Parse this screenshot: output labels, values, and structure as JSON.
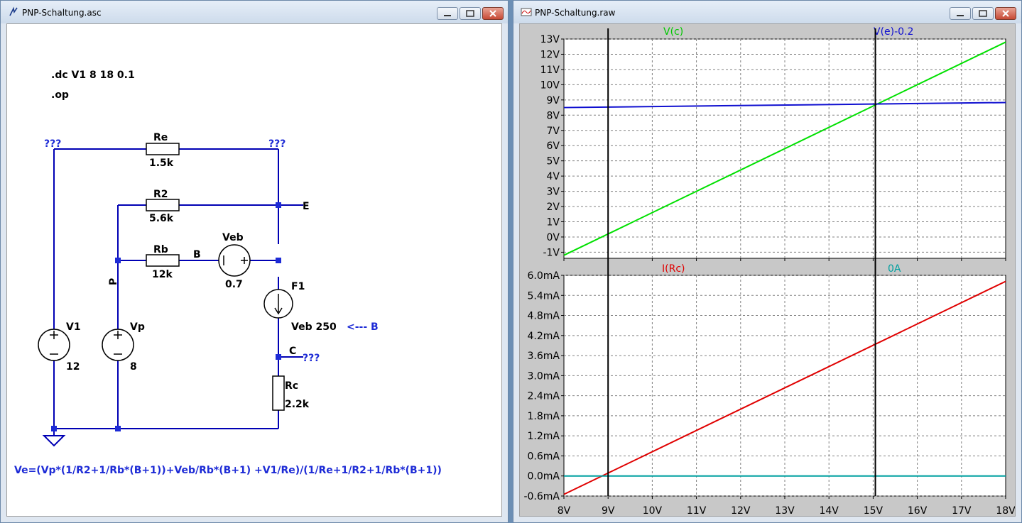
{
  "left_window": {
    "title": "PNP-Schaltung.asc",
    "directives": [
      ".dc V1 8 18 0.1",
      ".op"
    ],
    "nodes": {
      "top_left_unknown": "???",
      "top_right_unknown": "???",
      "collector_unknown": "???",
      "node_E": "E",
      "node_B": "B",
      "node_C": "C",
      "node_P": "P"
    },
    "components": {
      "Re": {
        "name": "Re",
        "value": "1.5k"
      },
      "R2": {
        "name": "R2",
        "value": "5.6k"
      },
      "Rb": {
        "name": "Rb",
        "value": "12k"
      },
      "Veb": {
        "name": "Veb",
        "value": "0.7"
      },
      "F1": {
        "name": "F1",
        "value": "Veb 250"
      },
      "V1": {
        "name": "V1",
        "value": "12"
      },
      "Vp": {
        "name": "Vp",
        "value": "8"
      },
      "Rc": {
        "name": "Rc",
        "value": "2.2k"
      }
    },
    "arrow_note": "<--- B",
    "formula": "Ve=(Vp*(1/R2+1/Rb*(B+1))+Veb/Rb*(B+1) +V1/Re)/(1/Re+1/R2+1/Rb*(B+1))",
    "colors": {
      "wire": "#0000b4",
      "junction": "#1d2bd6",
      "text_blue": "#1d2bd6"
    }
  },
  "right_window": {
    "title": "PNP-Schaltung.raw",
    "top_pane": {
      "traces": [
        {
          "label": "V(c)",
          "color": "#00e000"
        },
        {
          "label": "V(e)-0.2",
          "color": "#1010d0"
        }
      ],
      "y_ticks": [
        "13V",
        "12V",
        "11V",
        "10V",
        "9V",
        "8V",
        "7V",
        "6V",
        "5V",
        "4V",
        "3V",
        "2V",
        "1V",
        "0V",
        "-1V"
      ]
    },
    "bottom_pane": {
      "traces": [
        {
          "label": "I(Rc)",
          "color": "#e00000"
        },
        {
          "label": "0A",
          "color": "#00a0a0"
        }
      ],
      "y_ticks": [
        "6.0mA",
        "5.4mA",
        "4.8mA",
        "4.2mA",
        "3.6mA",
        "3.0mA",
        "2.4mA",
        "1.8mA",
        "1.2mA",
        "0.6mA",
        "0.0mA",
        "-0.6mA"
      ]
    },
    "x_ticks": [
      "8V",
      "9V",
      "10V",
      "11V",
      "12V",
      "13V",
      "14V",
      "15V",
      "16V",
      "17V",
      "18V"
    ],
    "cursors": [
      "9V",
      "15.05V"
    ]
  },
  "chart_data": [
    {
      "type": "line",
      "xlim": [
        8,
        18
      ],
      "ylim": [
        -1.4,
        13
      ],
      "grid": true,
      "series": [
        {
          "name": "V(c)",
          "x": [
            8,
            18
          ],
          "y": [
            -1.2,
            12.8
          ]
        },
        {
          "name": "V(e)-0.2",
          "x": [
            8,
            18
          ],
          "y": [
            8.5,
            8.83
          ]
        }
      ]
    },
    {
      "type": "line",
      "xlim": [
        8,
        18
      ],
      "ylim": [
        -0.6,
        6.0
      ],
      "grid": true,
      "series": [
        {
          "name": "I(Rc)",
          "x": [
            8,
            18
          ],
          "y": [
            -0.55,
            5.82
          ]
        },
        {
          "name": "0A",
          "x": [
            8,
            18
          ],
          "y": [
            0,
            0
          ]
        }
      ]
    }
  ]
}
